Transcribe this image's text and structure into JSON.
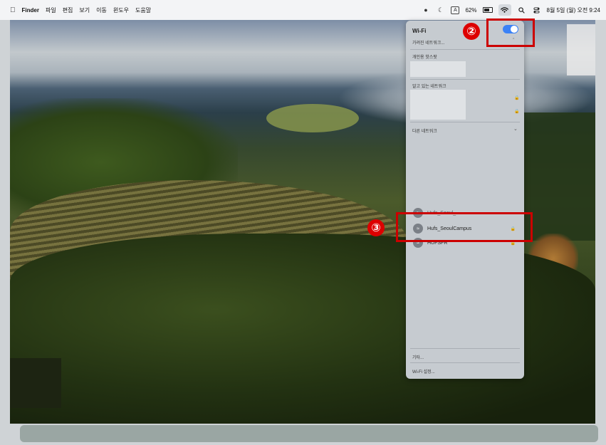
{
  "menubar": {
    "apple": "",
    "app_name": "Finder",
    "menus": [
      "파일",
      "편집",
      "보기",
      "이동",
      "윈도우",
      "도움말"
    ],
    "battery_percent": "62%",
    "input_indicator": "A",
    "datetime": "8월 5일 (월) 오전 9:24",
    "icons": [
      "chat-icon",
      "moon-icon",
      "keyboard-input-icon",
      "battery-icon",
      "wifi-icon",
      "search-icon",
      "control-center-icon"
    ]
  },
  "wifi_menu": {
    "title": "Wi-Fi",
    "toggle_on": true,
    "toggle_color": "#3b82f6",
    "hidden_networks_label": "가려진 네트워크...",
    "personal_hotspot_label": "개인용 핫스팟",
    "known_networks_label": "알고 있는 네트워크",
    "other_networks_label": "다른 네트워크",
    "networks": [
      {
        "name": "Hufs_Seoul_...",
        "locked": true
      },
      {
        "name": "Hufs_SeoulCampus",
        "locked": true
      },
      {
        "name": "HUFSFR",
        "locked": true
      }
    ],
    "other_label": "기타...",
    "settings_label": "Wi-Fi 설정..."
  },
  "annotations": {
    "step2": "②",
    "step3": "③",
    "color": "#cc0000"
  }
}
